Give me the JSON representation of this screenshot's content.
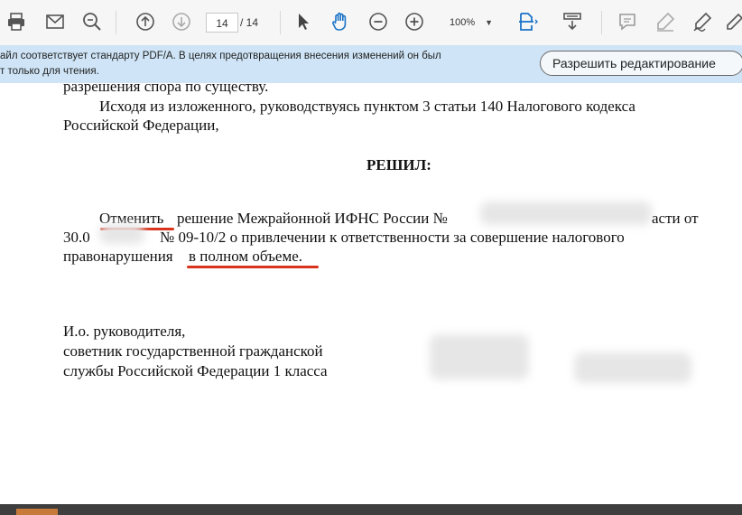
{
  "toolbar": {
    "icons": [
      "print-icon",
      "mail-icon",
      "zoom-search-icon",
      "page-up-icon",
      "page-down-icon",
      "select-arrow-icon",
      "hand-icon",
      "zoom-out-icon",
      "zoom-in-icon",
      "fit-page-icon",
      "scroll-mode-icon",
      "comment-icon",
      "highlight-pen-icon",
      "sign-icon"
    ],
    "page_current": "14",
    "page_total": "/ 14",
    "zoom": "100%"
  },
  "banner": {
    "line1": "айл соответствует стандарту PDF/A. В целях предотвращения внесения изменений он был",
    "line2": "т только для чтения.",
    "button": "Разрешить редактирование"
  },
  "document": {
    "line_top": "разрешения спора по существу.",
    "para1_line1": "Исходя из изложенного, руководствуясь пунктом 3 статьи 140 Налогового кодекса",
    "para1_line2": "Российской Федерации,",
    "heading": "РЕШИЛ:",
    "res_w1": "Отменить",
    "res_w2": "решение Межрайонной ИФНС России №",
    "res_w3": "асти от",
    "res_l2_a": "30.0",
    "res_l2_b": "№ 09-10/2 о привлечении к ответственности за совершение налогового",
    "res_l3_a": "правонарушения",
    "res_l3_b": "в полном объеме.",
    "sig1": "И.о. руководителя,",
    "sig2": "советник государственной гражданской",
    "sig3": "службы Российской Федерации 1 класса"
  },
  "colors": {
    "toolbar_bg": "#f6f6f6",
    "banner_bg": "#cfe5f7",
    "underline_red": "#d9331c",
    "icon_active_blue": "#1a73c7"
  }
}
